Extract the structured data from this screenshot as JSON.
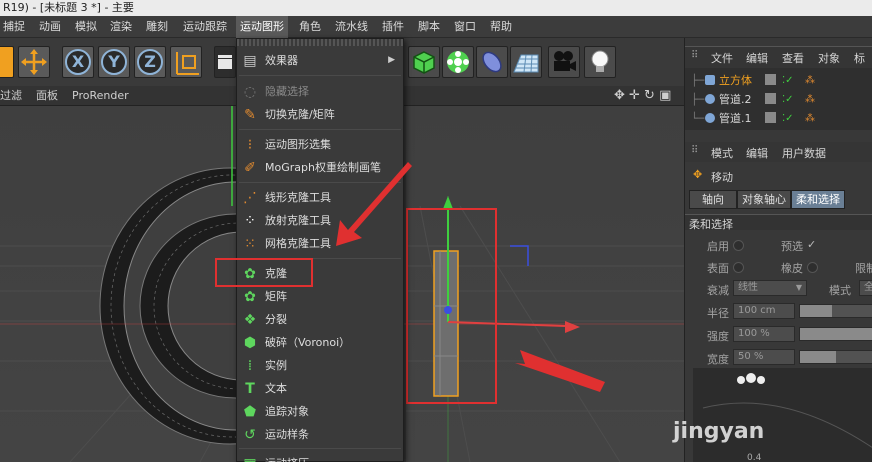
{
  "window": {
    "title": "R19) - [未标题 3 *] - 主要"
  },
  "menubar": {
    "items": [
      "捕捉",
      "动画",
      "模拟",
      "渲染",
      "雕刻",
      "运动跟踪",
      "运动图形",
      "角色",
      "流水线",
      "插件",
      "脚本",
      "窗口",
      "帮助"
    ],
    "active_index": 6
  },
  "toolbar": {
    "axis_buttons": [
      "X",
      "Y",
      "Z"
    ]
  },
  "viewport_bar": {
    "items": [
      "过滤",
      "面板",
      "ProRender"
    ]
  },
  "dropdown": {
    "items": [
      {
        "label": "效果器",
        "icon": "effector-icon",
        "submenu": true,
        "disabled": false
      },
      {
        "label": "隐藏选择",
        "icon": "hide-selection-icon",
        "disabled": true
      },
      {
        "label": "切换克隆/矩阵",
        "icon": "toggle-clone-icon",
        "disabled": false
      },
      {
        "label": "运动图形选集",
        "icon": "mograph-selection-icon",
        "disabled": false
      },
      {
        "label": "MoGraph权重绘制画笔",
        "icon": "weight-brush-icon",
        "disabled": false
      },
      {
        "label": "线形克隆工具",
        "icon": "linear-clone-icon",
        "disabled": false
      },
      {
        "label": "放射克隆工具",
        "icon": "radial-clone-icon",
        "disabled": false
      },
      {
        "label": "网格克隆工具",
        "icon": "grid-clone-icon",
        "disabled": false
      },
      {
        "label": "克隆",
        "icon": "cloner-icon",
        "disabled": false
      },
      {
        "label": "矩阵",
        "icon": "matrix-icon",
        "disabled": false
      },
      {
        "label": "分裂",
        "icon": "fracture-icon",
        "disabled": false
      },
      {
        "label": "破碎（Voronoi）",
        "icon": "voronoi-icon",
        "disabled": false
      },
      {
        "label": "实例",
        "icon": "instance-icon",
        "disabled": false
      },
      {
        "label": "文本",
        "icon": "text-icon",
        "disabled": false
      },
      {
        "label": "追踪对象",
        "icon": "tracer-icon",
        "disabled": false
      },
      {
        "label": "运动样条",
        "icon": "motion-spline-icon",
        "disabled": false
      },
      {
        "label": "运动挤压",
        "icon": "motion-extrude-icon",
        "disabled": false
      }
    ]
  },
  "object_manager": {
    "menu": [
      "文件",
      "编辑",
      "查看",
      "对象",
      "标签"
    ],
    "objects": [
      {
        "name": "立方体",
        "color": "#f0a020"
      },
      {
        "name": "管道.2",
        "color": "#d6d6d6"
      },
      {
        "name": "管道.1",
        "color": "#d6d6d6"
      }
    ]
  },
  "attribute_manager": {
    "menu": [
      "模式",
      "编辑",
      "用户数据"
    ],
    "title": "移动",
    "tabs": [
      "轴向",
      "对象轴心",
      "柔和选择"
    ],
    "active_tab": 2,
    "section": "柔和选择",
    "labels": {
      "enable": "启用",
      "preview": "预选",
      "surface": "表面",
      "rubber": "橡皮",
      "limit": "限制",
      "falloff": "衰减",
      "falloff_value": "线性",
      "mode": "模式",
      "mode_value": "全",
      "radius": "半径",
      "radius_value": "100 cm",
      "strength": "强度",
      "strength_value": "100 %",
      "width": "宽度",
      "width_value": "50 %",
      "bottom_value": "0.4"
    }
  },
  "watermark": {
    "text": "jingyan"
  },
  "colors": {
    "accent_red": "#e03030",
    "clone_green": "#5ed65e",
    "axis_green": "#3fcf3f",
    "axis_red": "#e04040",
    "axis_blue": "#3a4fe0"
  }
}
